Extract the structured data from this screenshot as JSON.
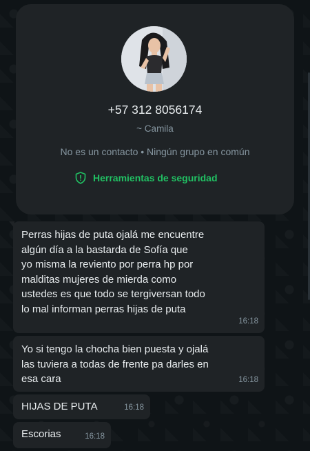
{
  "contact": {
    "phone": "+57 312 8056174",
    "name": "~ Camila",
    "meta": "No es un contacto • Ningún grupo en común",
    "security_label": "Herramientas de seguridad",
    "security_icon": "shield-icon"
  },
  "messages": [
    {
      "text": "Perras hijas de puta ojalá me encuentre\nalgún día a la bastarda de Sofía que\nyo misma la reviento por perra hp por\nmalditas mujeres de mierda como\nustedes es que todo se tergiversan todo\nlo mal informan perras hijas de puta",
      "time": "16:18"
    },
    {
      "text": "Yo si tengo la chocha bien puesta y ojalá\nlas tuviera a todas de frente pa darles en\nesa cara",
      "time": "16:18"
    },
    {
      "text": "HIJAS DE PUTA",
      "time": "16:18"
    },
    {
      "text": "Escorias",
      "time": "16:18"
    }
  ],
  "colors": {
    "background": "#0b141a",
    "bubble": "#1f2326",
    "accent_green": "#21c063",
    "text_primary": "#e9edef",
    "text_secondary": "#8696a0"
  }
}
